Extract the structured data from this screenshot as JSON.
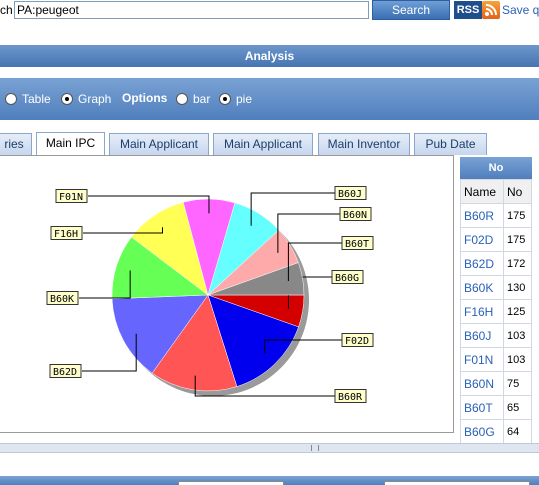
{
  "search": {
    "prefix": "ch",
    "value": "PA:peugeot",
    "button_label": "Search",
    "rss_label": "RSS",
    "save_label": "Save q"
  },
  "analysis": {
    "title": "Analysis"
  },
  "view": {
    "table_label": "Table",
    "graph_label": "Graph",
    "options_label": "Options",
    "bar_label": "bar",
    "pie_label": "pie"
  },
  "tabs": [
    {
      "label": "ries"
    },
    {
      "label": "Main IPC"
    },
    {
      "label": "Main Applicant"
    },
    {
      "label": "Main Applicant"
    },
    {
      "label": "Main Inventor"
    },
    {
      "label": "Pub Date"
    }
  ],
  "table": {
    "header": "No",
    "col_name": "Name",
    "col_no": "No",
    "rows": [
      {
        "name": "B60R",
        "no": "175"
      },
      {
        "name": "F02D",
        "no": "175"
      },
      {
        "name": "B62D",
        "no": "172"
      },
      {
        "name": "B60K",
        "no": "130"
      },
      {
        "name": "F16H",
        "no": "125"
      },
      {
        "name": "B60J",
        "no": "103"
      },
      {
        "name": "F01N",
        "no": "103"
      },
      {
        "name": "B60N",
        "no": "75"
      },
      {
        "name": "B60T",
        "no": "65"
      },
      {
        "name": "B60G",
        "no": "64"
      }
    ]
  },
  "chart_data": {
    "type": "pie",
    "categories": [
      "B60G",
      "F02D",
      "B60R",
      "B62D",
      "B60K",
      "F16H",
      "F01N",
      "B60J",
      "B60N",
      "B60T"
    ],
    "values": [
      64,
      175,
      175,
      172,
      130,
      125,
      103,
      103,
      75,
      65
    ],
    "colors": [
      "#d40000",
      "#0000ee",
      "#ff5555",
      "#6666ff",
      "#66ff55",
      "#ffff55",
      "#ff66ff",
      "#66ffff",
      "#ffaaaa",
      "#888888"
    ],
    "start_angle_deg": 0,
    "direction": "clockwise",
    "legend": "callout-labels"
  }
}
